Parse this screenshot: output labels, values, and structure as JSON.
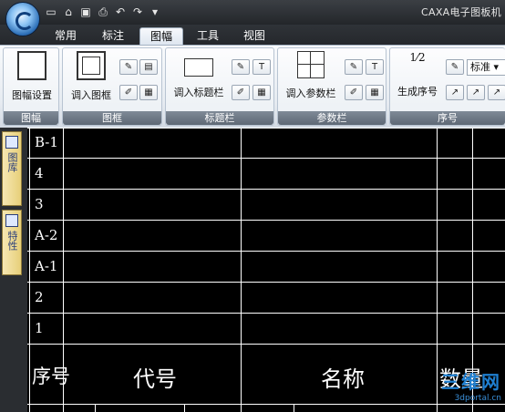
{
  "window": {
    "title": "CAXA电子图板机"
  },
  "quick_access": [
    "new-icon",
    "open-icon",
    "save-icon",
    "print-icon",
    "undo-icon",
    "redo-icon"
  ],
  "tabs": [
    {
      "label": "常用"
    },
    {
      "label": "标注"
    },
    {
      "label": "图幅",
      "active": true
    },
    {
      "label": "工具"
    },
    {
      "label": "视图"
    }
  ],
  "ribbon": {
    "groups": [
      {
        "label": "图幅",
        "buttons": [
          {
            "label": "图幅设置"
          }
        ]
      },
      {
        "label": "图框",
        "buttons": [
          {
            "label": "调入图框"
          }
        ]
      },
      {
        "label": "标题栏",
        "buttons": [
          {
            "label": "调入标题栏"
          }
        ]
      },
      {
        "label": "参数栏",
        "buttons": [
          {
            "label": "调入参数栏"
          }
        ]
      },
      {
        "label": "序号",
        "buttons": [
          {
            "label": "生成序号"
          }
        ],
        "style_select": "标准"
      }
    ]
  },
  "side_tabs": [
    {
      "label": "图库"
    },
    {
      "label": "特性"
    }
  ],
  "canvas": {
    "rows": [
      "B-1",
      "4",
      "3",
      "A-2",
      "A-1",
      "2",
      "1"
    ],
    "header": {
      "c1": "序号",
      "c2": "代号",
      "c3": "名称",
      "c4": "数量"
    }
  },
  "watermark": {
    "main": "三维网",
    "sub": "3dportal.cn"
  }
}
